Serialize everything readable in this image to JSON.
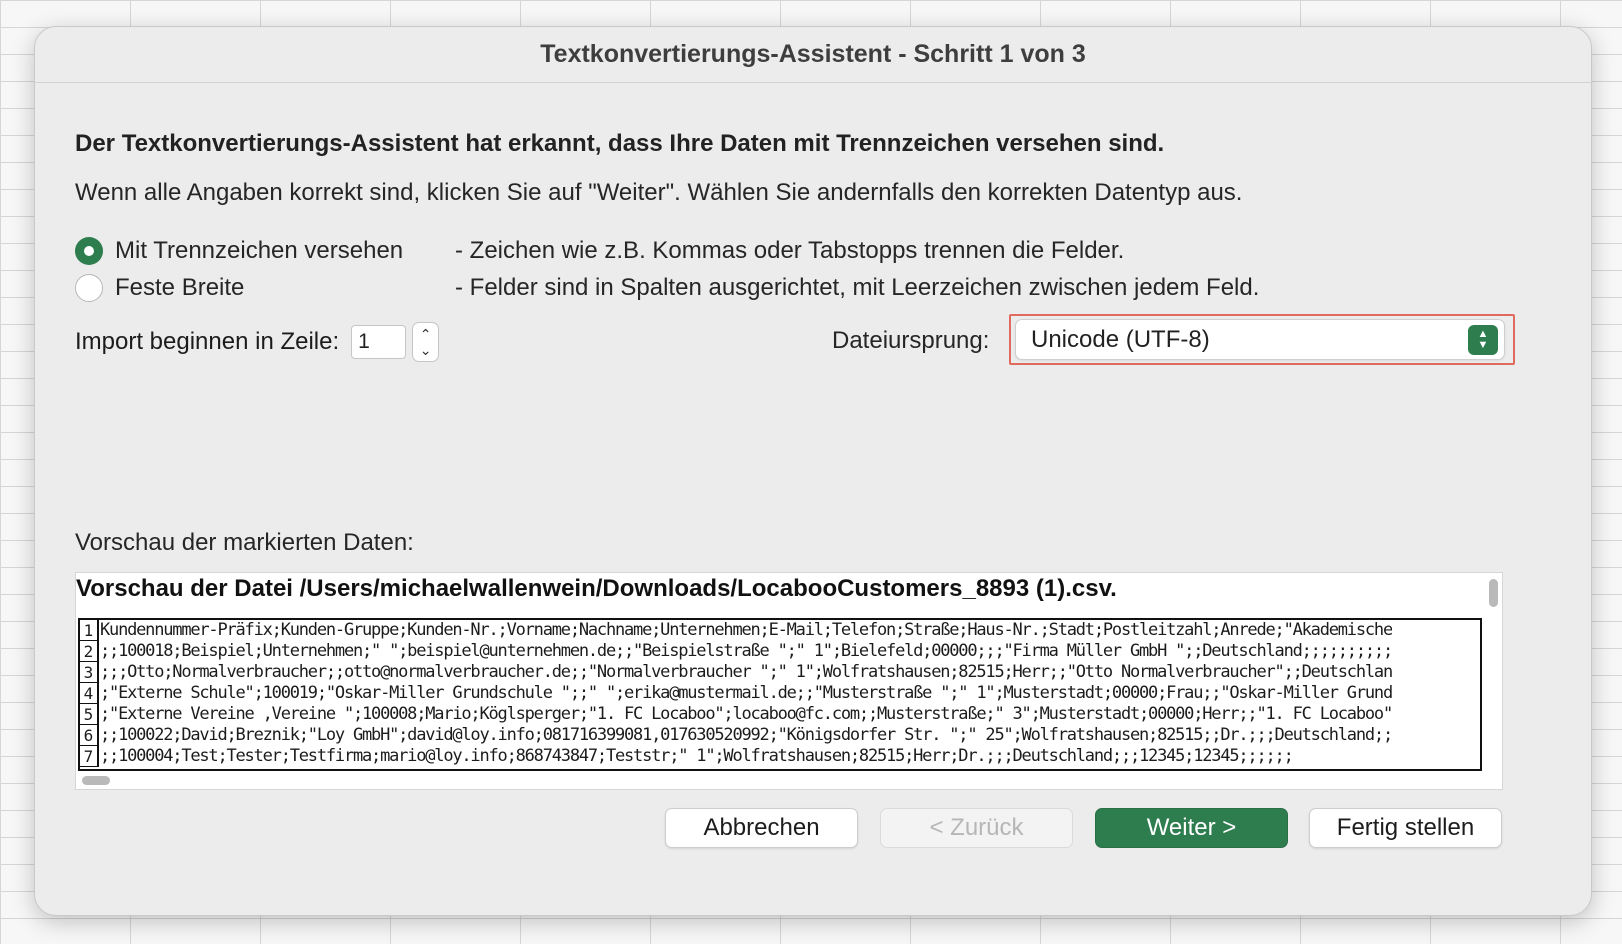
{
  "dialog": {
    "title": "Textkonvertierungs-Assistent - Schritt 1 von 3",
    "heading": "Der Textkonvertierungs-Assistent hat erkannt, dass Ihre Daten mit Trennzeichen versehen sind.",
    "subtext": "Wenn alle Angaben korrekt sind, klicken Sie auf \"Weiter\". Wählen Sie andernfalls den korrekten Datentyp aus."
  },
  "data_type": {
    "options": [
      {
        "label": "Mit Trennzeichen versehen",
        "description": "- Zeichen wie z.B. Kommas oder Tabstopps trennen die Felder.",
        "selected": true
      },
      {
        "label": "Feste Breite",
        "description": "- Felder sind in Spalten ausgerichtet, mit Leerzeichen zwischen jedem Feld.",
        "selected": false
      }
    ]
  },
  "import_start": {
    "label": "Import beginnen in Zeile:",
    "value": "1"
  },
  "file_origin": {
    "label": "Dateiursprung:",
    "value": "Unicode (UTF-8)"
  },
  "preview": {
    "caption": "Vorschau der markierten Daten:",
    "title": "Vorschau der Datei /Users/michaelwallenwein/Downloads/LocabooCustomers_8893 (1).csv.",
    "rows": [
      {
        "num": "1",
        "text": "Kundennummer-Präfix;Kunden-Gruppe;Kunden-Nr.;Vorname;Nachname;Unternehmen;E-Mail;Telefon;Straße;Haus-Nr.;Stadt;Postleitzahl;Anrede;\"Akademische"
      },
      {
        "num": "2",
        "text": ";;100018;Beispiel;Unternehmen;\" \";beispiel@unternehmen.de;;\"Beispielstraße \";\" 1\";Bielefeld;00000;;;\"Firma Müller GmbH \";;Deutschland;;;;;;;;;;"
      },
      {
        "num": "3",
        "text": ";;;Otto;Normalverbraucher;;otto@normalverbraucher.de;;\"Normalverbraucher \";\" 1\";Wolfratshausen;82515;Herr;;\"Otto Normalverbraucher\";;Deutschlan"
      },
      {
        "num": "4",
        "text": ";\"Externe Schule\";100019;\"Oskar-Miller Grundschule \";;\" \";erika@mustermail.de;;\"Musterstraße \";\" 1\";Musterstadt;00000;Frau;;\"Oskar-Miller Grund"
      },
      {
        "num": "5",
        "text": ";\"Externe Vereine ,Vereine \";100008;Mario;Köglsperger;\"1. FC Locaboo\";locaboo@fc.com;;Musterstraße;\" 3\";Musterstadt;00000;Herr;;\"1. FC Locaboo\""
      },
      {
        "num": "6",
        "text": ";;100022;David;Breznik;\"Loy GmbH\";david@loy.info;081716399081,017630520992;\"Königsdorfer Str. \";\" 25\";Wolfratshausen;82515;;Dr.;;;Deutschland;;"
      },
      {
        "num": "7",
        "text": ";;100004;Test;Tester;Testfirma;mario@loy.info;868743847;Teststr;\" 1\";Wolfratshausen;82515;Herr;Dr.;;;Deutschland;;;12345;12345;;;;;;"
      }
    ]
  },
  "buttons": {
    "cancel": "Abbrechen",
    "back": "< Zurück",
    "next": "Weiter >",
    "finish": "Fertig stellen"
  },
  "colors": {
    "accent": "#2e7d4f",
    "highlight_frame": "#e06a5f"
  }
}
